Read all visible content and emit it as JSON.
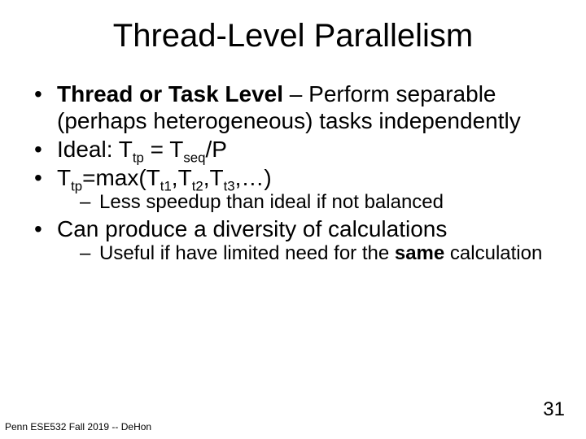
{
  "title": "Thread-Level Parallelism",
  "bullets": {
    "b1_strong": "Thread or Task Level",
    "b1_rest": " – Perform separable (perhaps heterogeneous) tasks independently",
    "b2_pre": "Ideal: T",
    "b2_sub1": "tp",
    "b2_mid": " = T",
    "b2_sub2": "seq",
    "b2_post": "/P",
    "b3_pre": "T",
    "b3_s1": "tp",
    "b3_m1": "=max(T",
    "b3_s2": "t1",
    "b3_m2": ",T",
    "b3_s3": "t2",
    "b3_m3": ",T",
    "b3_s4": "t3",
    "b3_m4": ",…)",
    "b3_sub": "Less speedup than ideal if not balanced",
    "b4": "Can produce a diversity of calculations",
    "b4_sub_pre": "Useful if have limited need for the ",
    "b4_sub_strong": "same",
    "b4_sub_post": " calculation"
  },
  "footer_left": "Penn ESE532 Fall 2019 -- DeHon",
  "page_number": "31"
}
